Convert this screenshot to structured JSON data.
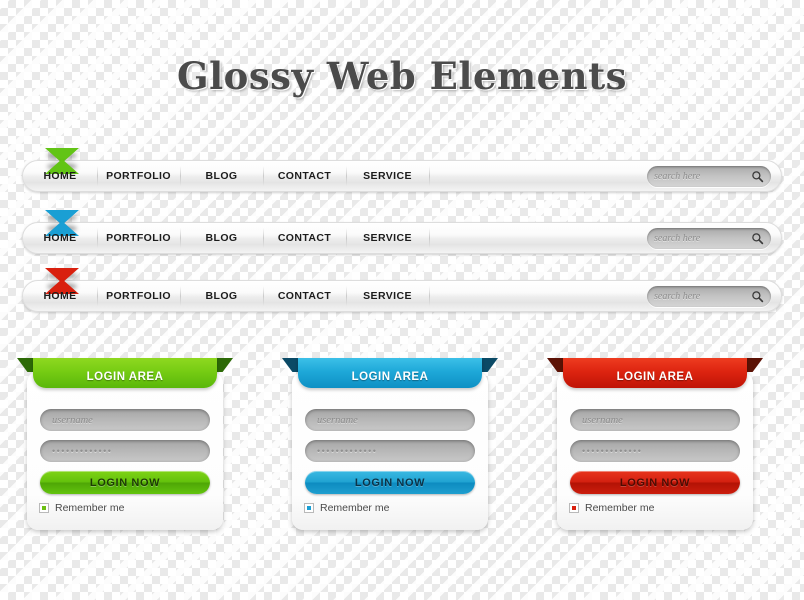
{
  "page": {
    "title": "Glossy Web Elements"
  },
  "navbars": [
    {
      "variant": "green",
      "accent": "#62c415",
      "arrow_top_icon": "triangle-down-icon",
      "arrow_bottom_icon": "triangle-up-icon",
      "items": [
        "HOME",
        "PORTFOLIO",
        "BLOG",
        "CONTACT",
        "SERVICE"
      ],
      "search": {
        "placeholder": "search here",
        "value": "",
        "icon": "search-icon"
      }
    },
    {
      "variant": "blue",
      "accent": "#1a9fd4",
      "arrow_top_icon": "triangle-down-icon",
      "arrow_bottom_icon": "triangle-up-icon",
      "items": [
        "HOME",
        "PORTFOLIO",
        "BLOG",
        "CONTACT",
        "SERVICE"
      ],
      "search": {
        "placeholder": "search here",
        "value": "",
        "icon": "search-icon"
      }
    },
    {
      "variant": "red",
      "accent": "#d9200e",
      "arrow_top_icon": "triangle-down-icon",
      "arrow_bottom_icon": "triangle-up-icon",
      "items": [
        "HOME",
        "PORTFOLIO",
        "BLOG",
        "CONTACT",
        "SERVICE"
      ],
      "search": {
        "placeholder": "search here",
        "value": "",
        "icon": "search-icon"
      }
    }
  ],
  "login_cards": [
    {
      "variant": "green",
      "accent": "#62c415",
      "banner": "LOGIN AREA",
      "username": {
        "placeholder": "username",
        "value": ""
      },
      "password": {
        "value": "•••••••••••••"
      },
      "submit": "LOGIN NOW",
      "remember": {
        "label": "Remember me",
        "checked": true
      }
    },
    {
      "variant": "blue",
      "accent": "#1a9fd4",
      "banner": "LOGIN AREA",
      "username": {
        "placeholder": "username",
        "value": ""
      },
      "password": {
        "value": "•••••••••••••"
      },
      "submit": "LOGIN NOW",
      "remember": {
        "label": "Remember me",
        "checked": true
      }
    },
    {
      "variant": "red",
      "accent": "#d9200e",
      "banner": "LOGIN AREA",
      "username": {
        "placeholder": "username",
        "value": ""
      },
      "password": {
        "value": "•••••••••••••"
      },
      "submit": "LOGIN NOW",
      "remember": {
        "label": "Remember me",
        "checked": true
      }
    }
  ]
}
